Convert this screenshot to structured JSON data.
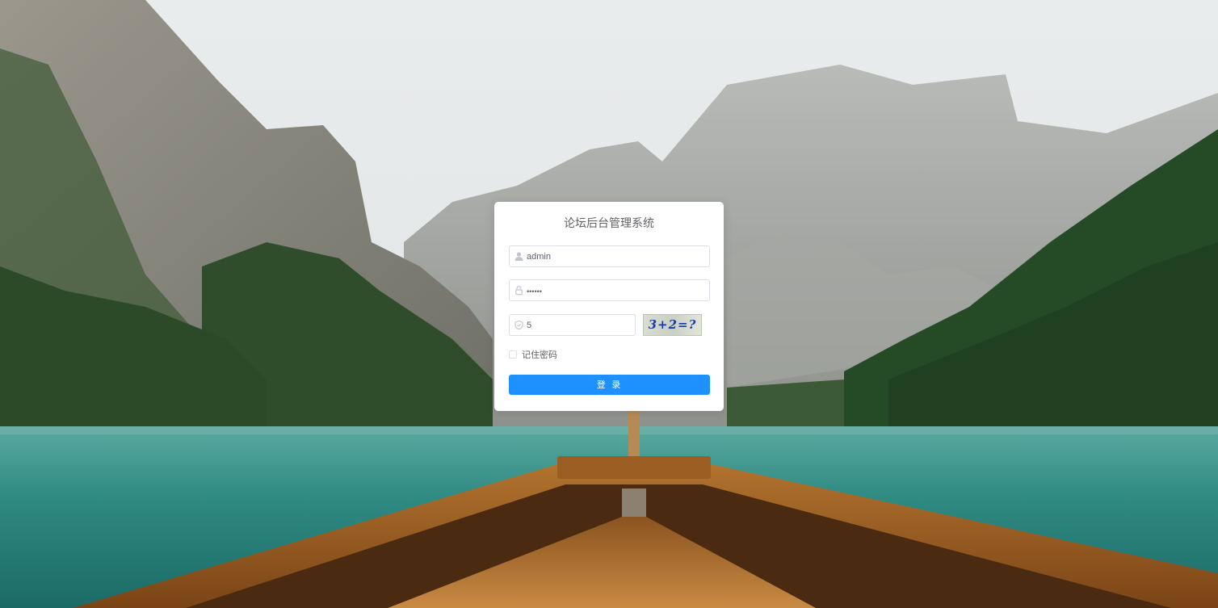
{
  "page": {
    "title": "论坛后台管理系统"
  },
  "form": {
    "username_value": "admin",
    "password_value": "••••••",
    "captcha_value": "5",
    "captcha_image_text": "3+2=?",
    "remember_label": "记住密码",
    "remember_checked": false,
    "login_label": "登 录"
  },
  "icons": {
    "username": "user-icon",
    "password": "lock-icon",
    "captcha": "shield-icon"
  },
  "colors": {
    "primary": "#1e90ff",
    "card_bg": "#ffffff",
    "border": "#dcdfe6",
    "text": "#606266"
  }
}
